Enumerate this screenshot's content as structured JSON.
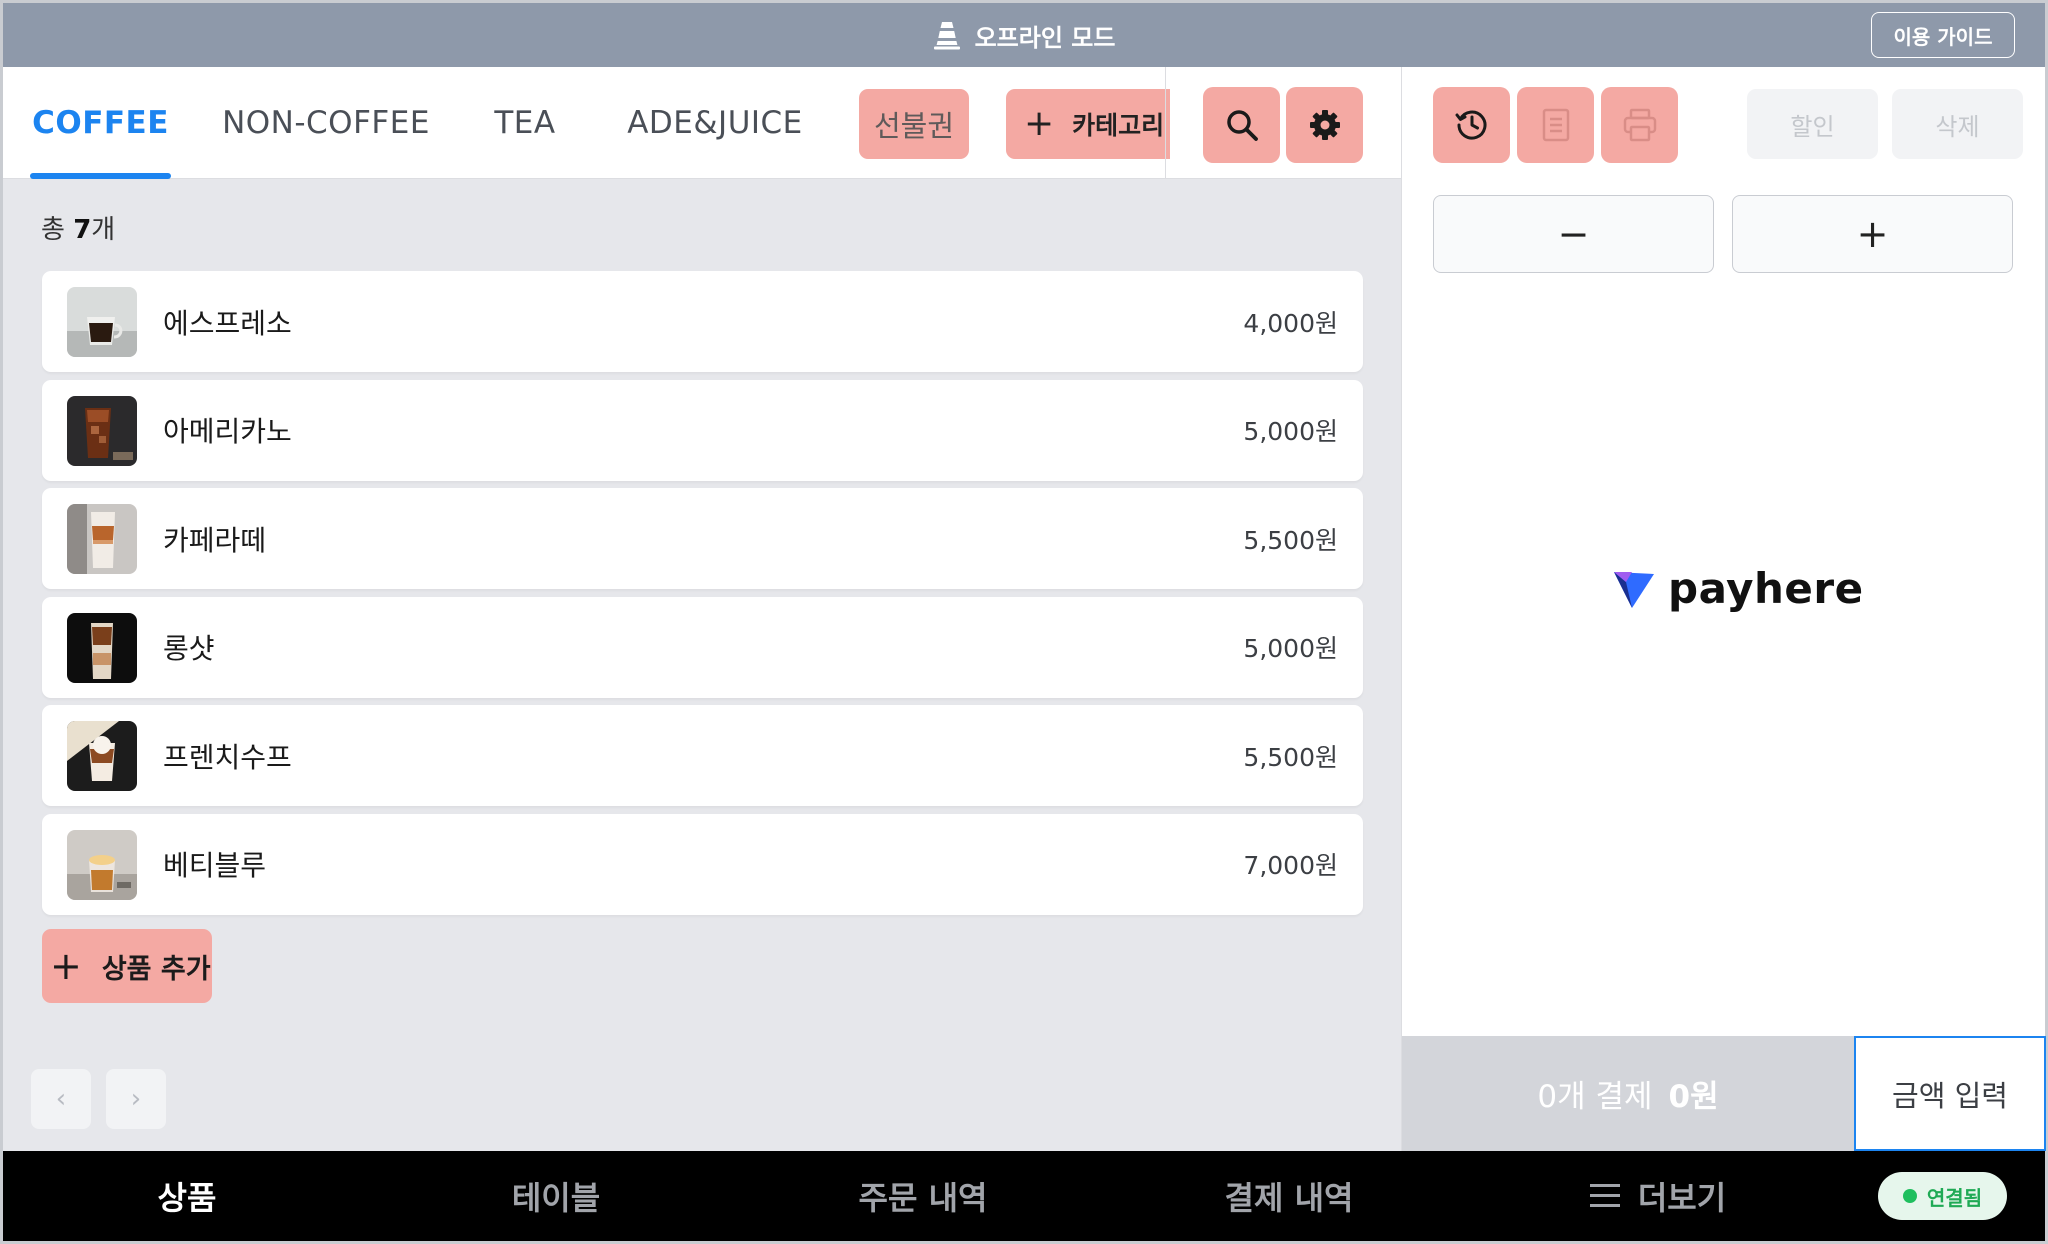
{
  "topbar": {
    "title": "오프라인 모드",
    "icon": "traffic-cone-icon",
    "guide_label": "이용 가이드"
  },
  "tabs": [
    {
      "label": "COFFEE",
      "active": true
    },
    {
      "label": "NON-COFFEE",
      "active": false
    },
    {
      "label": "TEA",
      "active": false
    },
    {
      "label": "ADE&JUICE",
      "active": false
    }
  ],
  "toolbar": {
    "prepaid_label": "선불권",
    "category_label": "카테고리",
    "search_icon": "search-icon",
    "settings_icon": "gear-icon"
  },
  "summary": {
    "prefix": "총 ",
    "count": "7",
    "suffix": "개"
  },
  "products": [
    {
      "name": "에스프레소",
      "price": "4,000원"
    },
    {
      "name": "아메리카노",
      "price": "5,000원"
    },
    {
      "name": "카페라떼",
      "price": "5,500원"
    },
    {
      "name": "롱샷",
      "price": "5,000원"
    },
    {
      "name": "프렌치수프",
      "price": "5,500원"
    },
    {
      "name": "베티블루",
      "price": "7,000원"
    }
  ],
  "add_product_label": "상품 추가",
  "pagination": {
    "prev": "‹",
    "next": "›"
  },
  "order_panel": {
    "discount_label": "할인",
    "delete_label": "삭제",
    "minus_label": "−",
    "plus_label": "+",
    "logo_text": "payhere",
    "pay_count_label": "0개 결제",
    "pay_amount": "0원",
    "amount_input_label": "금액 입력"
  },
  "bottom_nav": [
    {
      "label": "상품",
      "active": true
    },
    {
      "label": "테이블",
      "active": false
    },
    {
      "label": "주문 내역",
      "active": false
    },
    {
      "label": "결제 내역",
      "active": false
    },
    {
      "label": "더보기",
      "active": false
    }
  ],
  "connection": {
    "label": "연결됨",
    "color": "#1fbf5e"
  },
  "colors": {
    "accent": "#1c84f0",
    "action_pink": "#f4a9a3",
    "topbar": "#8e99aa"
  }
}
